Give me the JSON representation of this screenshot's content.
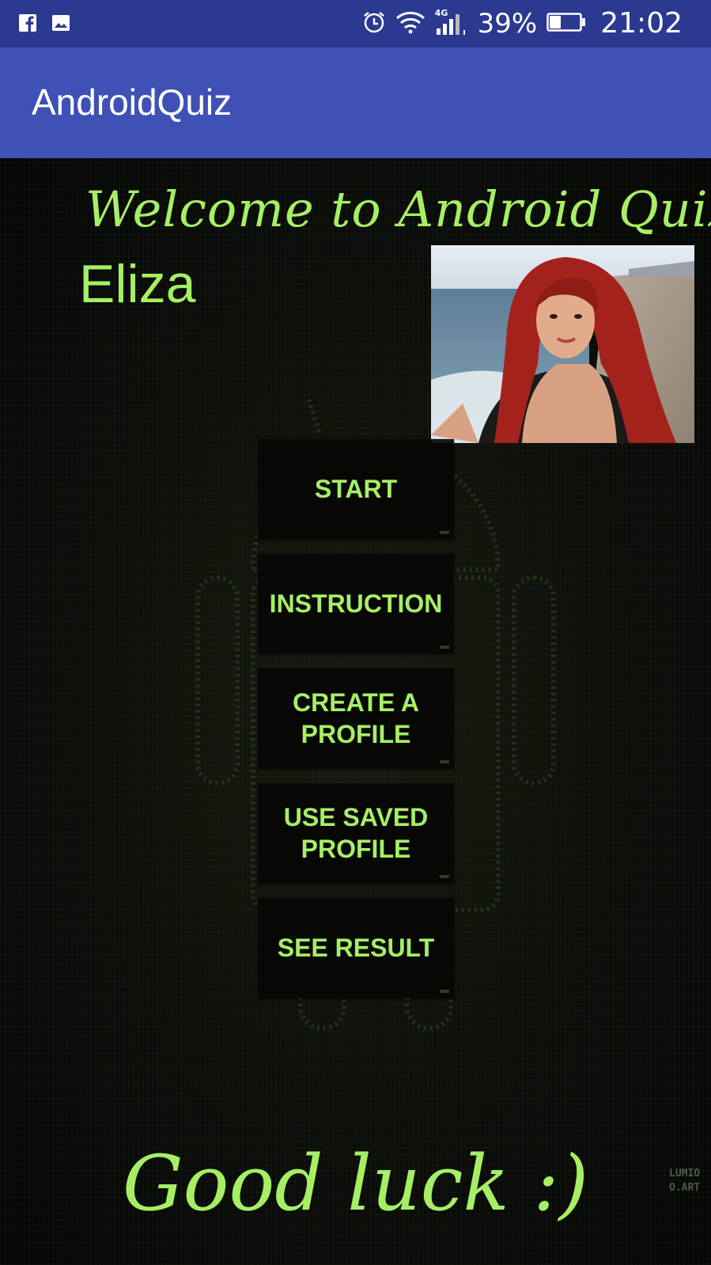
{
  "status_bar": {
    "battery_percent": "39%",
    "time": "21:02",
    "network": "4G",
    "battery_level": 0.39,
    "icons": [
      "facebook-icon",
      "gallery-icon",
      "alarm-icon",
      "wifi-icon",
      "signal-icon",
      "battery-icon"
    ]
  },
  "app_bar": {
    "title": "AndroidQuiz"
  },
  "main": {
    "welcome": "Welcome to Android Quiz",
    "user_name": "Eliza",
    "buttons": [
      {
        "label": "START"
      },
      {
        "label": "INSTRUCTION"
      },
      {
        "label": "CREATE A PROFILE"
      },
      {
        "label": "USE SAVED PROFILE"
      },
      {
        "label": "SEE RESULT"
      }
    ],
    "footer": "Good luck :)",
    "watermark": [
      "LUMIO",
      "O.ART"
    ]
  },
  "colors": {
    "status_bar": "#2b3990",
    "app_bar": "#3f51b5",
    "accent_green": "#a6ef64",
    "button_bg": "#060605"
  }
}
